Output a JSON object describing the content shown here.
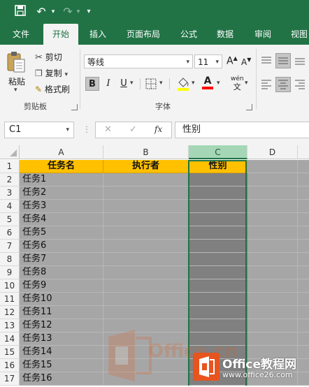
{
  "quick_access": {
    "save_icon": "save-icon",
    "undo_icon": "undo-icon",
    "redo_icon": "redo-icon",
    "customize_icon": "customize-icon"
  },
  "tabs": [
    "文件",
    "开始",
    "插入",
    "页面布局",
    "公式",
    "数据",
    "审阅",
    "视图"
  ],
  "ribbon": {
    "paste_label": "粘贴",
    "cut_label": "剪切",
    "copy_label": "复制",
    "format_painter_label": "格式刷",
    "clipboard_group": "剪贴板",
    "font_name": "等线",
    "font_size": "11",
    "grow_font": "A",
    "shrink_font": "A",
    "bold": "B",
    "italic": "I",
    "underline": "U",
    "font_color_letter": "A",
    "phonetic_top": "wén",
    "phonetic_bottom": "文",
    "font_group": "字体"
  },
  "formula_bar": {
    "name_box": "C1",
    "cancel": "✕",
    "enter": "✓",
    "fx": "fx",
    "value": "性别"
  },
  "columns": [
    "A",
    "B",
    "C",
    "D"
  ],
  "rows": [
    "1",
    "2",
    "3",
    "4",
    "5",
    "6",
    "7",
    "8",
    "9",
    "10",
    "11",
    "12",
    "13",
    "14",
    "15",
    "16",
    "17"
  ],
  "header_row": [
    "任务名",
    "执行者",
    "性别"
  ],
  "tasks": [
    "任务1",
    "任务2",
    "任务3",
    "任务4",
    "任务5",
    "任务6",
    "任务7",
    "任务8",
    "任务9",
    "任务10",
    "任务11",
    "任务12",
    "任务13",
    "任务14",
    "任务15",
    "任务16"
  ],
  "watermark": {
    "text1": "Office.cn",
    "text2": "Office教程网",
    "text3": "www.office26.com"
  },
  "colors": {
    "brand": "#217346",
    "header_fill": "#ffc000",
    "cell_gray": "#a6a6a6",
    "selected_col": "#808080"
  }
}
